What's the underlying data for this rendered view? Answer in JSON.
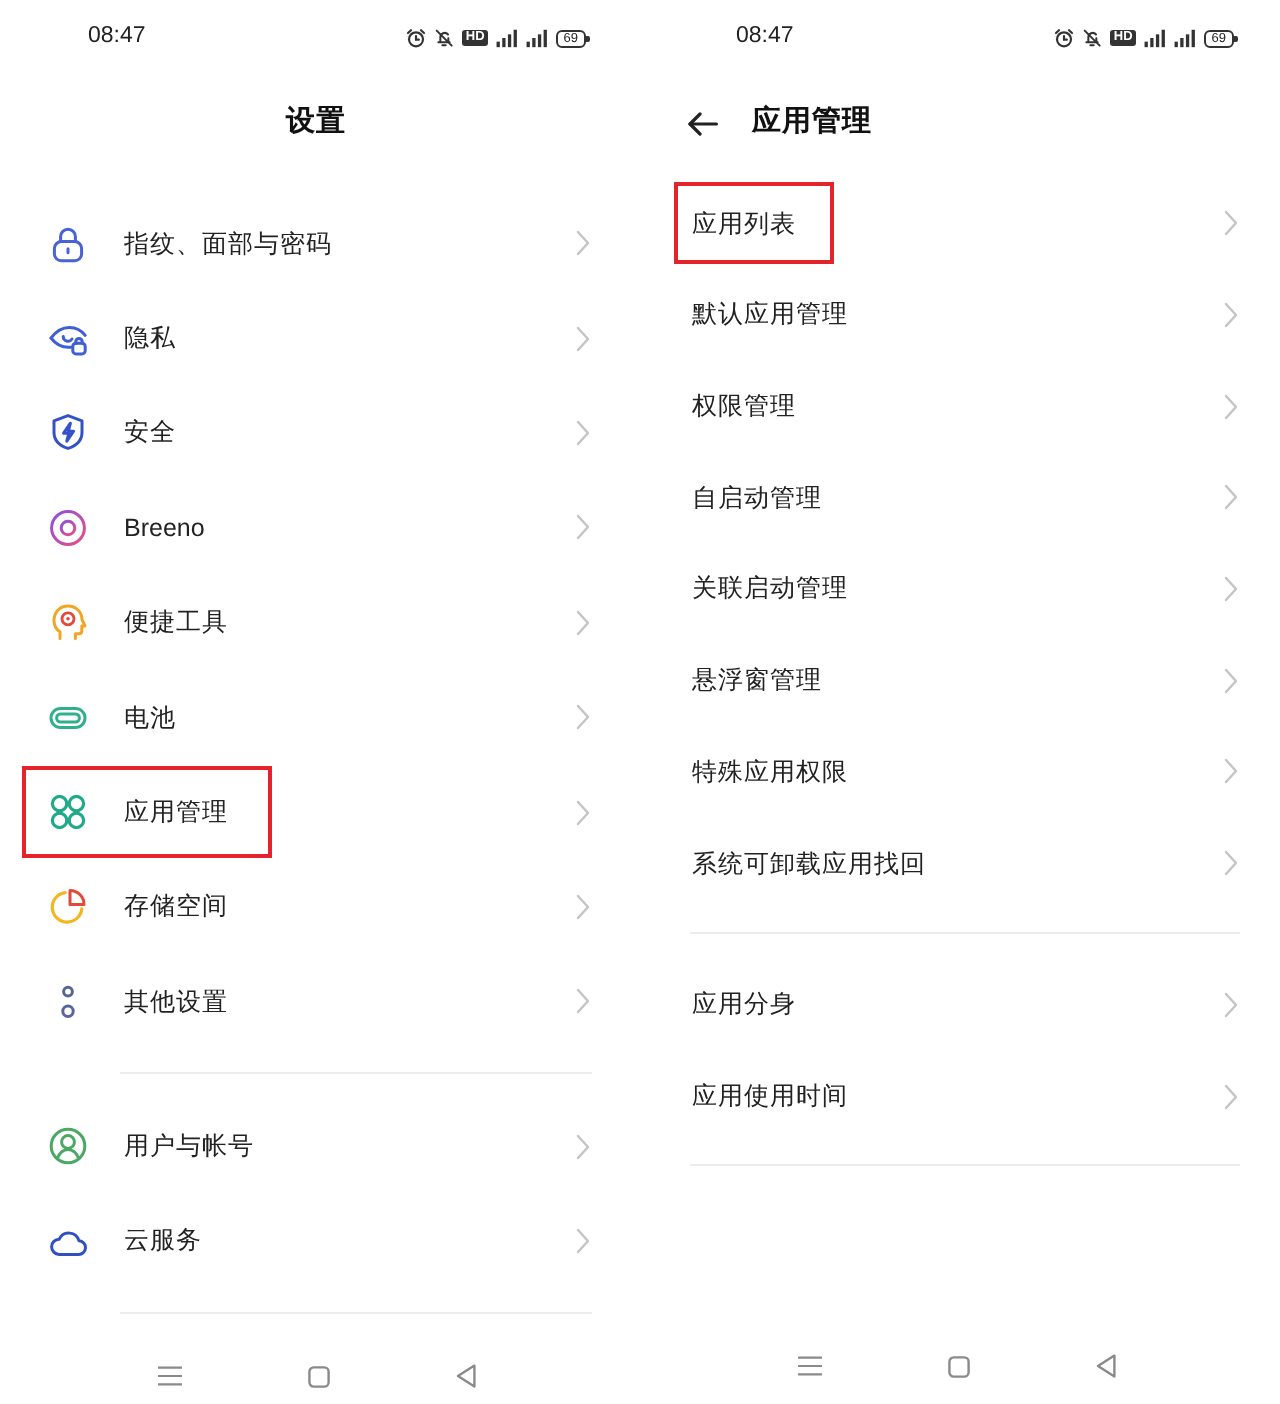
{
  "screens": [
    {
      "status_bar": {
        "time": "08:47",
        "hd": "HD",
        "battery": "69"
      },
      "header": {
        "title": "设置",
        "back": false
      },
      "groups": [
        {
          "items": [
            {
              "label": "指纹、面部与密码",
              "kind": "icon",
              "highlighted": false
            },
            {
              "label": "隐私",
              "kind": "icon",
              "highlighted": false
            },
            {
              "label": "安全",
              "kind": "icon",
              "highlighted": false
            },
            {
              "label": "Breeno",
              "kind": "icon",
              "highlighted": false
            },
            {
              "label": "便捷工具",
              "kind": "icon",
              "highlighted": false
            },
            {
              "label": "电池",
              "kind": "icon",
              "highlighted": false
            },
            {
              "label": "应用管理",
              "kind": "icon",
              "highlighted": true
            },
            {
              "label": "存储空间",
              "kind": "icon",
              "highlighted": false
            },
            {
              "label": "其他设置",
              "kind": "icon",
              "highlighted": false
            }
          ]
        },
        {
          "items": [
            {
              "label": "用户与帐号",
              "kind": "icon",
              "highlighted": false
            },
            {
              "label": "云服务",
              "kind": "icon",
              "highlighted": false
            }
          ]
        }
      ]
    },
    {
      "status_bar": {
        "time": "08:47",
        "hd": "HD",
        "battery": "69"
      },
      "header": {
        "title": "应用管理",
        "back": true
      },
      "groups": [
        {
          "items": [
            {
              "label": "应用列表",
              "kind": "plain",
              "highlighted": true
            },
            {
              "label": "默认应用管理",
              "kind": "plain",
              "highlighted": false
            },
            {
              "label": "权限管理",
              "kind": "plain",
              "highlighted": false
            },
            {
              "label": "自启动管理",
              "kind": "plain",
              "highlighted": false
            },
            {
              "label": "关联启动管理",
              "kind": "plain",
              "highlighted": false
            },
            {
              "label": "悬浮窗管理",
              "kind": "plain",
              "highlighted": false
            },
            {
              "label": "特殊应用权限",
              "kind": "plain",
              "highlighted": false
            },
            {
              "label": "系统可卸载应用找回",
              "kind": "plain",
              "highlighted": false
            }
          ]
        },
        {
          "items": [
            {
              "label": "应用分身",
              "kind": "plain",
              "highlighted": false
            },
            {
              "label": "应用使用时间",
              "kind": "plain",
              "highlighted": false
            }
          ]
        }
      ]
    }
  ]
}
